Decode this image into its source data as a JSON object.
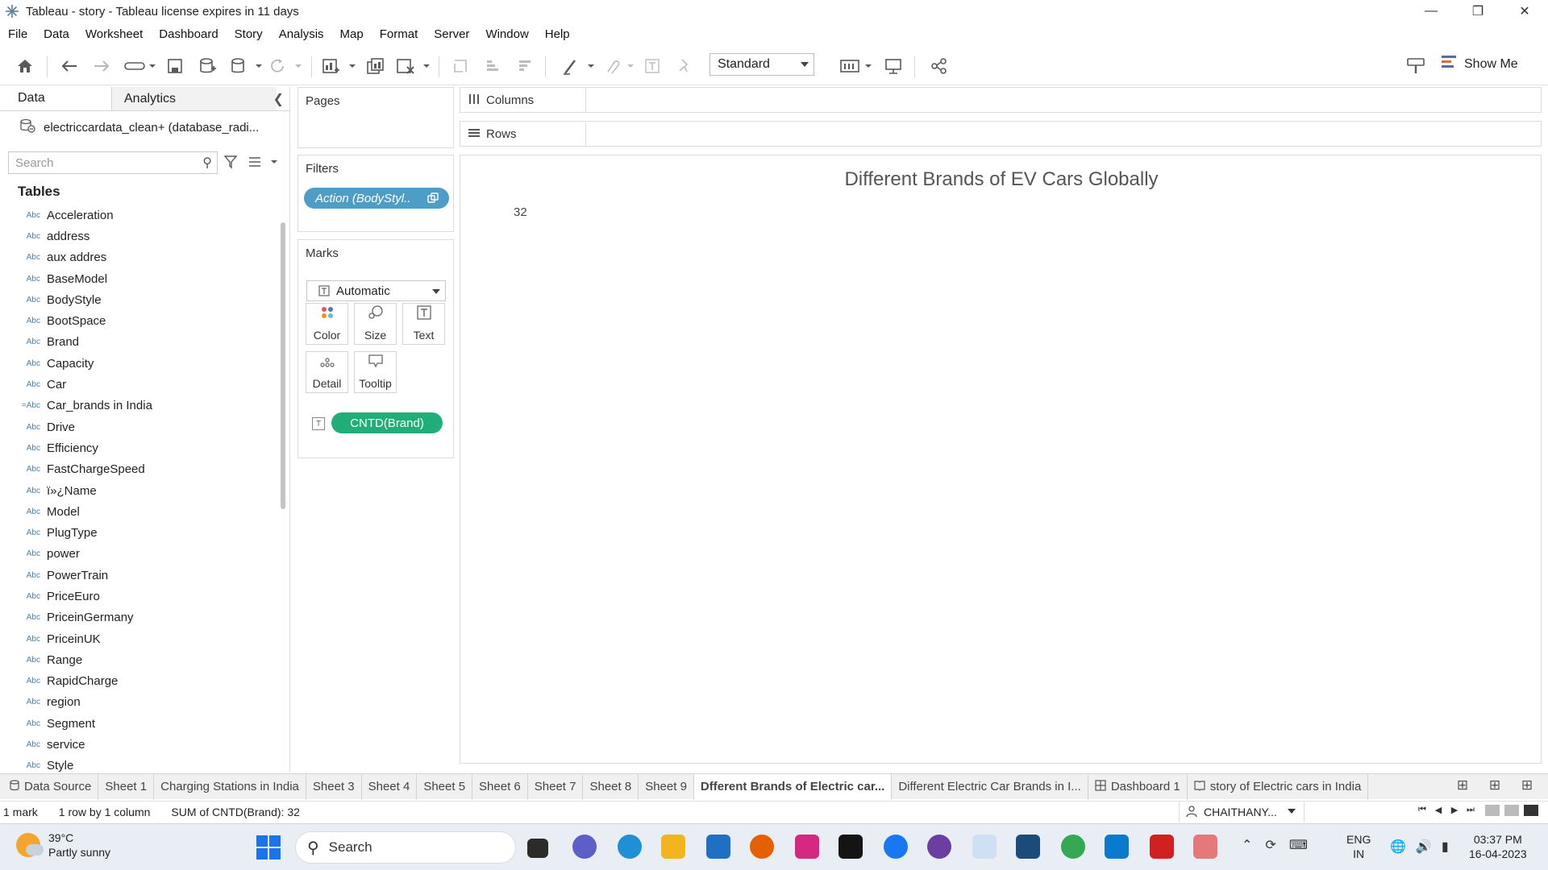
{
  "window": {
    "title": "Tableau - story - Tableau license expires in 11 days",
    "controls": [
      "—",
      "❐",
      "✕"
    ]
  },
  "menu": [
    "File",
    "Data",
    "Worksheet",
    "Dashboard",
    "Story",
    "Analysis",
    "Map",
    "Format",
    "Server",
    "Window",
    "Help"
  ],
  "toolbar": {
    "fit_select": "Standard",
    "show_me": "Show Me"
  },
  "datapane": {
    "tab_data": "Data",
    "tab_analytics": "Analytics",
    "datasource": "electriccardata_clean+ (database_radi...",
    "search_placeholder": "Search",
    "tables_heading": "Tables",
    "fields": [
      {
        "type": "Abc",
        "name": "Acceleration"
      },
      {
        "type": "Abc",
        "name": "address"
      },
      {
        "type": "Abc",
        "name": "aux addres"
      },
      {
        "type": "Abc",
        "name": "BaseModel"
      },
      {
        "type": "Abc",
        "name": "BodyStyle"
      },
      {
        "type": "Abc",
        "name": "BootSpace"
      },
      {
        "type": "Abc",
        "name": "Brand"
      },
      {
        "type": "Abc",
        "name": "Capacity"
      },
      {
        "type": "Abc",
        "name": "Car"
      },
      {
        "type": "=Abc",
        "name": "Car_brands in India"
      },
      {
        "type": "Abc",
        "name": "Drive"
      },
      {
        "type": "Abc",
        "name": "Efficiency"
      },
      {
        "type": "Abc",
        "name": "FastChargeSpeed"
      },
      {
        "type": "Abc",
        "name": "ï»¿Name"
      },
      {
        "type": "Abc",
        "name": "Model"
      },
      {
        "type": "Abc",
        "name": "PlugType"
      },
      {
        "type": "Abc",
        "name": "power"
      },
      {
        "type": "Abc",
        "name": "PowerTrain"
      },
      {
        "type": "Abc",
        "name": "PriceEuro"
      },
      {
        "type": "Abc",
        "name": "PriceinGermany"
      },
      {
        "type": "Abc",
        "name": "PriceinUK"
      },
      {
        "type": "Abc",
        "name": "Range"
      },
      {
        "type": "Abc",
        "name": "RapidCharge"
      },
      {
        "type": "Abc",
        "name": "region"
      },
      {
        "type": "Abc",
        "name": "Segment"
      },
      {
        "type": "Abc",
        "name": "service"
      },
      {
        "type": "Abc",
        "name": "Style"
      }
    ]
  },
  "cards": {
    "pages": "Pages",
    "filters": "Filters",
    "filter_pill": "Action (BodyStyl..",
    "marks": "Marks",
    "mark_type": "Automatic",
    "mark_buttons": [
      "Color",
      "Size",
      "Text",
      "Detail",
      "Tooltip"
    ],
    "measure_pill": "CNTD(Brand)"
  },
  "shelves": {
    "columns": "Columns",
    "rows": "Rows"
  },
  "viz": {
    "title": "Different Brands of EV Cars Globally",
    "value": "32"
  },
  "sheet_tabs": [
    {
      "label": "Data Source",
      "active": false
    },
    {
      "label": "Sheet 1",
      "active": false
    },
    {
      "label": "Charging Stations in India",
      "active": false
    },
    {
      "label": "Sheet 3",
      "active": false
    },
    {
      "label": "Sheet 4",
      "active": false
    },
    {
      "label": "Sheet 5",
      "active": false
    },
    {
      "label": "Sheet 6",
      "active": false
    },
    {
      "label": "Sheet 7",
      "active": false
    },
    {
      "label": "Sheet 8",
      "active": false
    },
    {
      "label": "Sheet 9",
      "active": false
    },
    {
      "label": "Dfferent Brands of Electric car...",
      "active": true
    },
    {
      "label": "Different Electric Car Brands in I...",
      "active": false
    },
    {
      "label": "Dashboard 1",
      "active": false
    },
    {
      "label": "story of Electric cars in India",
      "active": false
    }
  ],
  "status": {
    "marks": "1 mark",
    "rows": "1 row by 1 column",
    "sum": "SUM of CNTD(Brand): 32",
    "user": "CHAITHANY..."
  },
  "taskbar": {
    "temperature": "39°C",
    "weather": "Partly sunny",
    "search": "Search",
    "lang1": "ENG",
    "lang2": "IN",
    "time": "03:37 PM",
    "date": "16-04-2023"
  }
}
